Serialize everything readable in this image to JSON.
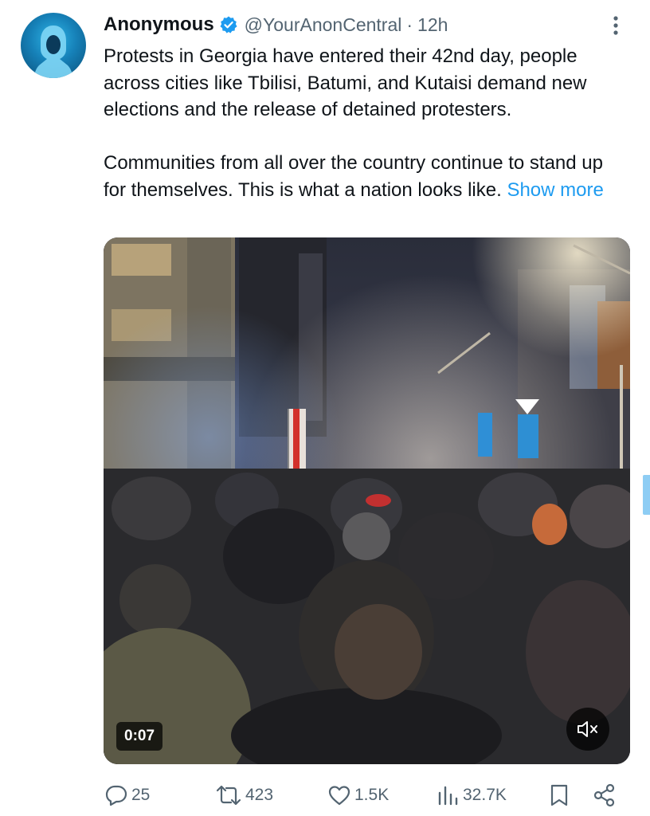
{
  "tweet": {
    "author_name": "Anonymous",
    "handle": "@YourAnonCentral",
    "separator": "·",
    "time": "12h",
    "text_paragraph_1": "Protests in Georgia have entered their 42nd day, people across cities like Tbilisi, Batumi, and Kutaisi demand new elections and the release of detained protesters.",
    "text_paragraph_2": "Communities from all over the country continue to stand up for themselves. This is what a nation looks like.",
    "show_more": "Show more"
  },
  "media": {
    "duration": "0:07",
    "mute_icon": "speaker-muted-icon"
  },
  "actions": {
    "replies": "25",
    "reposts": "423",
    "likes": "1.5K",
    "views": "32.7K"
  },
  "icons": {
    "verified": "verified-badge-icon",
    "more": "more-vertical-icon",
    "reply": "reply-icon",
    "repost": "repost-icon",
    "like": "heart-icon",
    "views": "views-chart-icon",
    "bookmark": "bookmark-icon",
    "share": "share-icon"
  },
  "colors": {
    "verified": "#1d9bf0",
    "link": "#1d9bf0",
    "secondary_text": "#536471",
    "primary_text": "#0f1419"
  }
}
